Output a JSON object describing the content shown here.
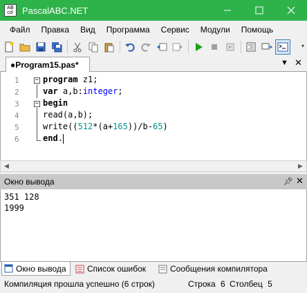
{
  "window": {
    "title": "PascalABC.NET",
    "app_icon_text": "AB\ncd"
  },
  "menu": [
    "Файл",
    "Правка",
    "Вид",
    "Программа",
    "Сервис",
    "Модули",
    "Помощь"
  ],
  "toolbar": {
    "icons": [
      "new-file",
      "open-file",
      "save",
      "save-all",
      "cut",
      "copy",
      "paste",
      "undo",
      "redo",
      "back",
      "forward",
      "run",
      "stop",
      "step",
      "format",
      "debug-window",
      "console-window"
    ]
  },
  "editor": {
    "tab_label": "●Program15.pas*",
    "lines": [
      {
        "num": "1",
        "code": "program z1;"
      },
      {
        "num": "2",
        "code": "var a,b:integer;"
      },
      {
        "num": "3",
        "code": "begin"
      },
      {
        "num": "4",
        "code": "read(a,b);"
      },
      {
        "num": "5",
        "code": "write((512*(a+165))/b-65)"
      },
      {
        "num": "6",
        "code": "end."
      }
    ]
  },
  "output_panel": {
    "title": "Окно вывода",
    "lines": [
      "351 128",
      "1999"
    ]
  },
  "bottom_tabs": [
    "Окно вывода",
    "Список ошибок",
    "Сообщения компилятора"
  ],
  "status": {
    "message": "Компиляция прошла успешно (6 строк)",
    "row_label": "Строка",
    "row_value": "6",
    "col_label": "Столбец",
    "col_value": "5"
  },
  "colors": {
    "titlebar": "#2db34a",
    "keyword_type": "#0000ff",
    "number": "#009090"
  }
}
